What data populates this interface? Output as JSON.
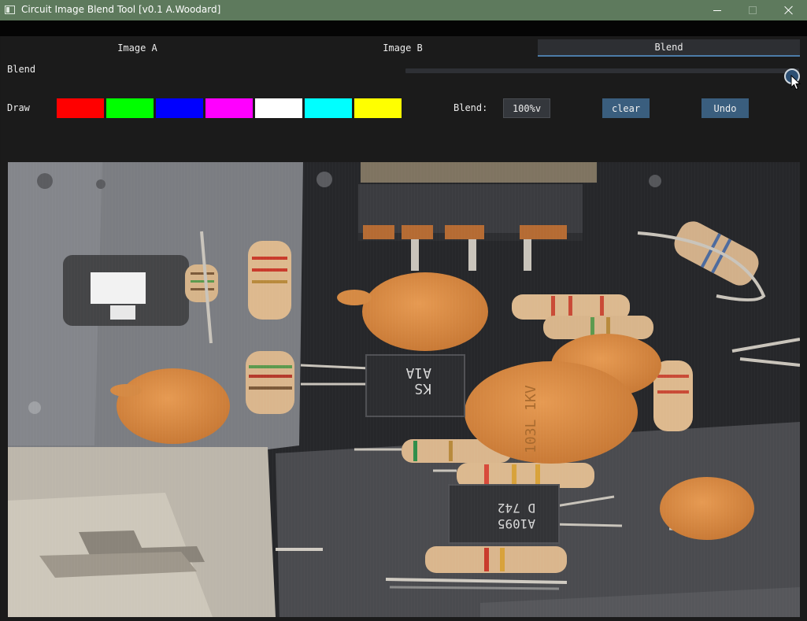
{
  "window": {
    "title": "Circuit Image Blend Tool [v0.1 A.Woodard]"
  },
  "tabs": [
    {
      "label": "Image A",
      "active": false
    },
    {
      "label": "Image B",
      "active": false
    },
    {
      "label": "Blend",
      "active": true
    }
  ],
  "blend_slider": {
    "label": "Blend",
    "value": 1.0
  },
  "draw": {
    "label": "Draw",
    "colors": [
      "#ff0000",
      "#00ff00",
      "#0000ff",
      "#ff00ff",
      "#ffffff",
      "#00ffff",
      "#ffff00"
    ]
  },
  "blend_select": {
    "label": "Blend:",
    "value": "100%v"
  },
  "buttons": {
    "clear": "clear",
    "undo": "Undo"
  },
  "board_labels": {
    "transistor_top": "KS\nA1A",
    "capacitor_center": "103L\n1KV",
    "transistor_bottom": "A1095\nD 742"
  },
  "colors": {
    "titlebar": "#5e7a5d",
    "active_tab_underline": "#4c7ca8",
    "button": "#3a5e7e"
  }
}
